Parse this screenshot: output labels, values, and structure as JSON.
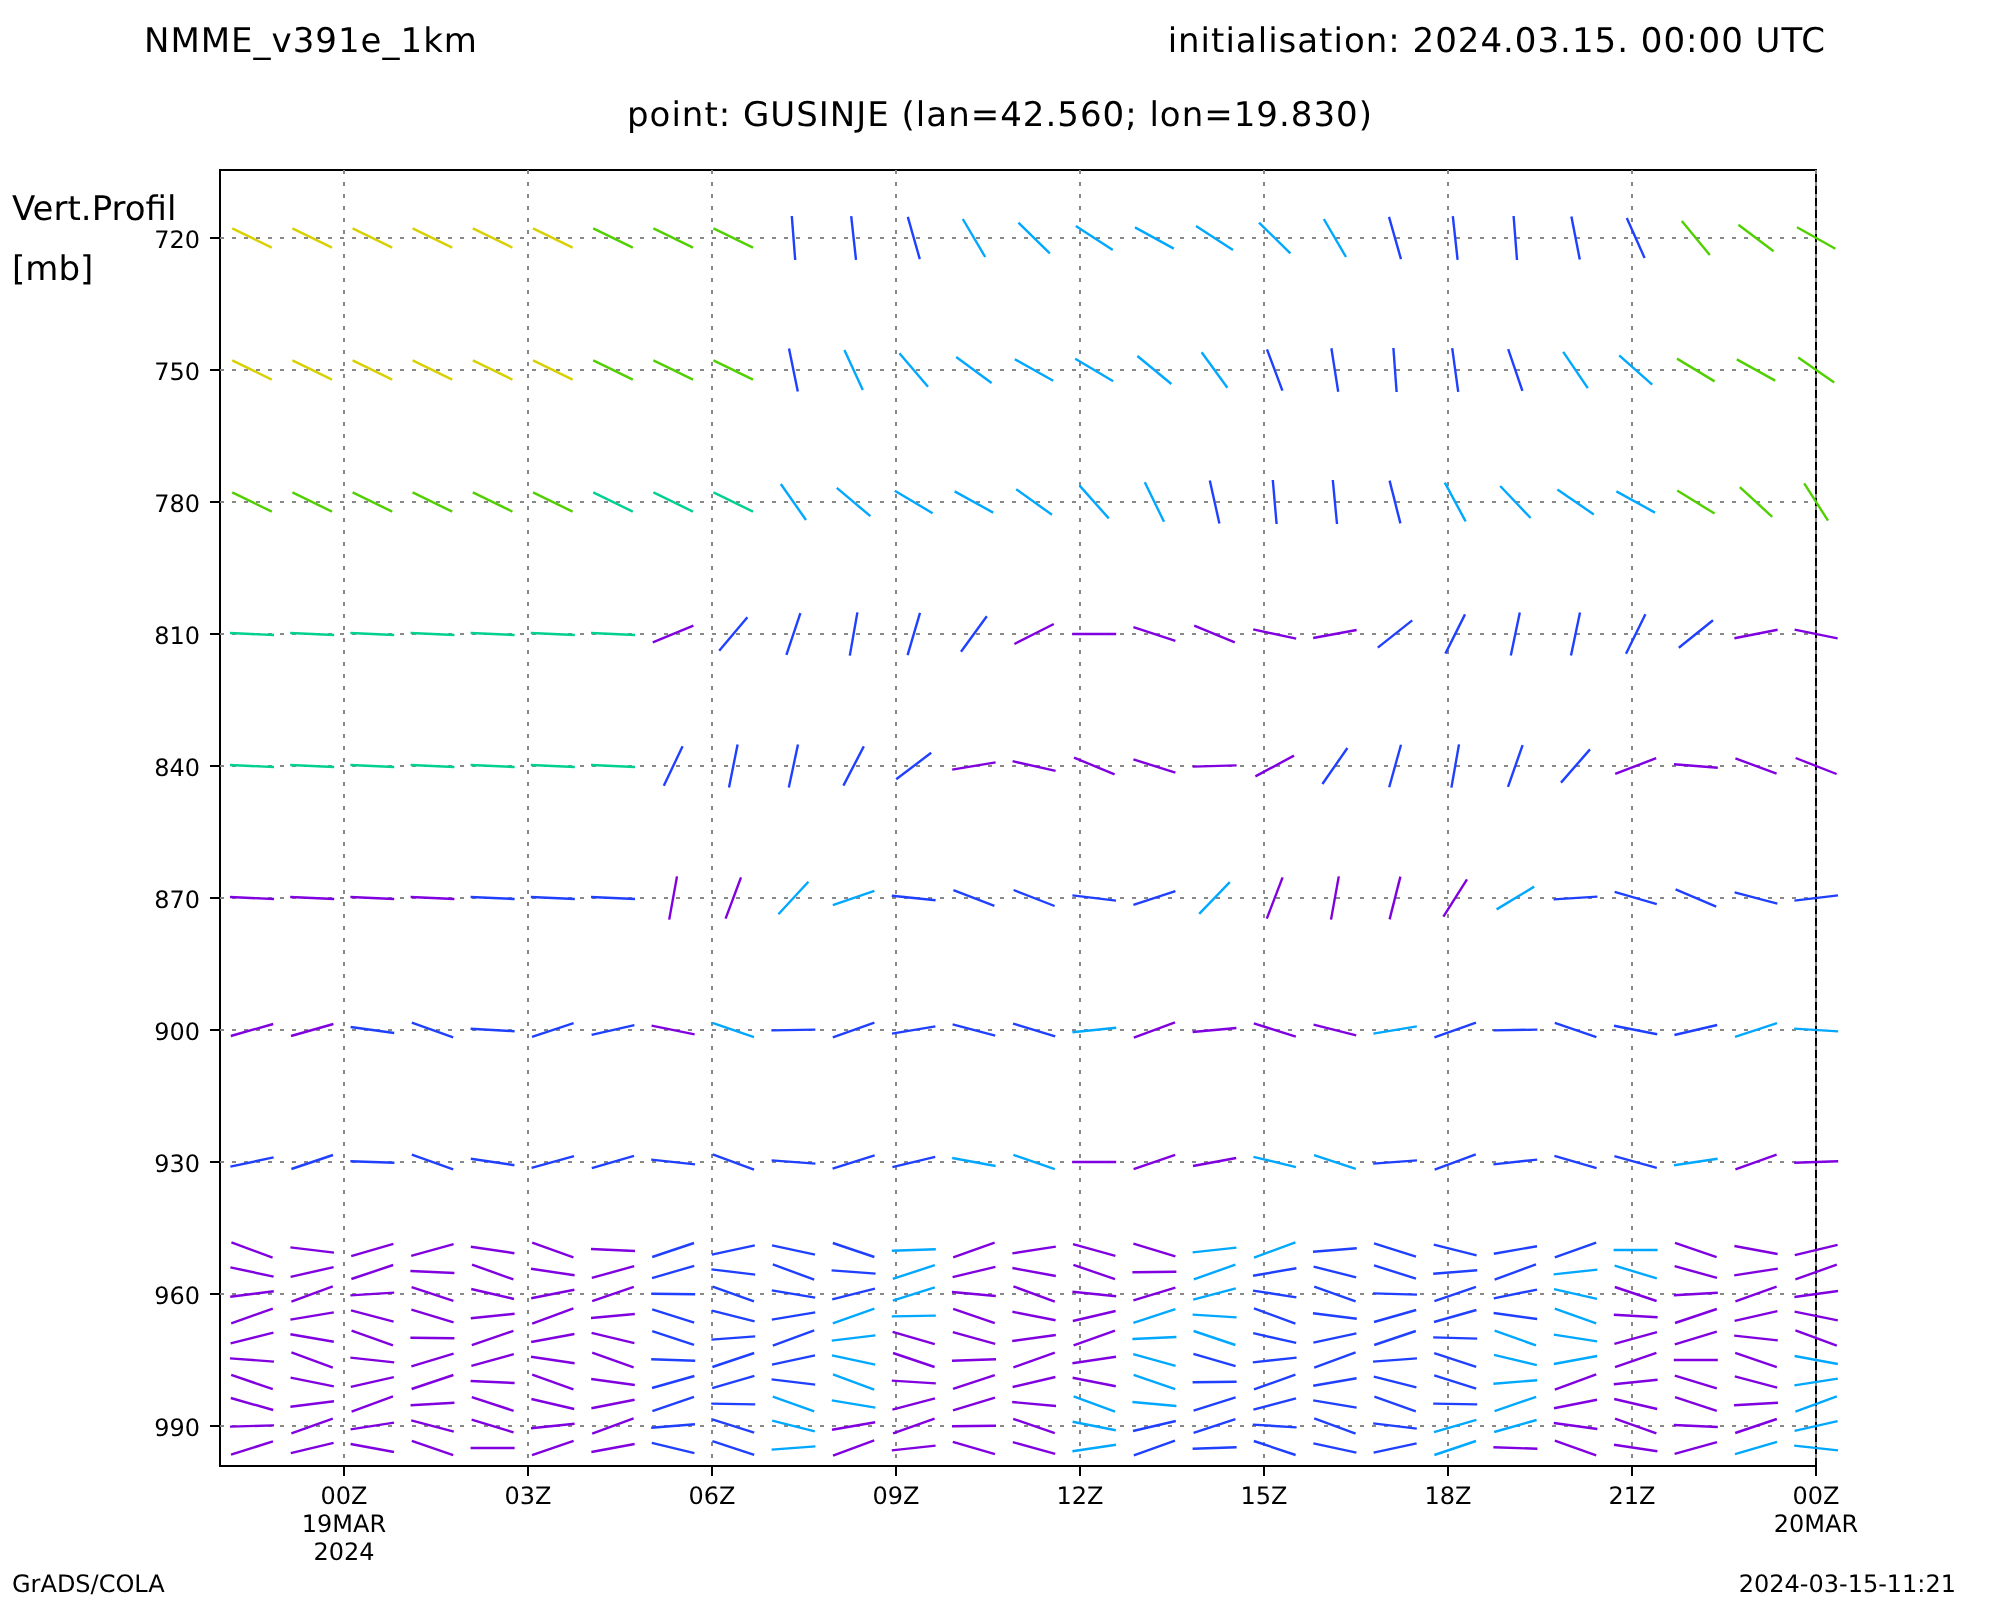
{
  "header": {
    "model": "NMME_v391e_1km",
    "initialisation": "initialisation: 2024.03.15. 00:00 UTC"
  },
  "title": "point: GUSINJE (lan=42.560; lon=19.830)",
  "y_axis": {
    "label": "Vert.Profil",
    "unit": "[mb]",
    "ticks": [
      "720",
      "750",
      "780",
      "810",
      "840",
      "870",
      "900",
      "930",
      "960",
      "990"
    ]
  },
  "x_axis": {
    "ticks": [
      {
        "label": "00Z",
        "date": "19MAR",
        "year": "2024"
      },
      {
        "label": "03Z"
      },
      {
        "label": "06Z"
      },
      {
        "label": "09Z"
      },
      {
        "label": "12Z"
      },
      {
        "label": "15Z"
      },
      {
        "label": "18Z"
      },
      {
        "label": "21Z"
      },
      {
        "label": "00Z",
        "date": "20MAR"
      }
    ]
  },
  "footer": {
    "left": "GrADS/COLA",
    "right": "2024-03-15-11:21"
  }
}
